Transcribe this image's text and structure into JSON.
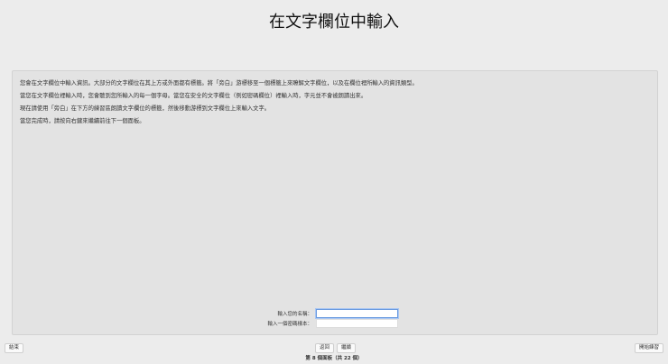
{
  "title": "在文字欄位中輸入",
  "paragraphs": [
    "您會在文字欄位中輸入資訊。大部分的文字欄位在其上方或外面都有標籤。將「旁白」游標移至一個標籤上來瞭解文字欄位，以及在欄位裡所輸入的資訊類型。",
    "當您在文字欄位裡輸入時，您會聽到您所輸入的每一個字母。當您在安全的文字欄位（例如密碼欄位）裡輸入時，字元並不會被朗讀出來。",
    "現在請使用「旁白」在下方的練習區朗讀文字欄位的標籤，然後移動游標到文字欄位上來輸入文字。",
    "當您完成時，請按向右鍵來繼續前往下一個面板。"
  ],
  "form": {
    "name_label": "輸入您的名稱：",
    "name_value": "",
    "password_label": "輸入一個密碼樣本：",
    "password_value": ""
  },
  "buttons": {
    "end": "結束",
    "back": "返回",
    "continue": "繼續",
    "start_practice": "開始練習"
  },
  "status": "第 8 個面板（共 22 個）"
}
